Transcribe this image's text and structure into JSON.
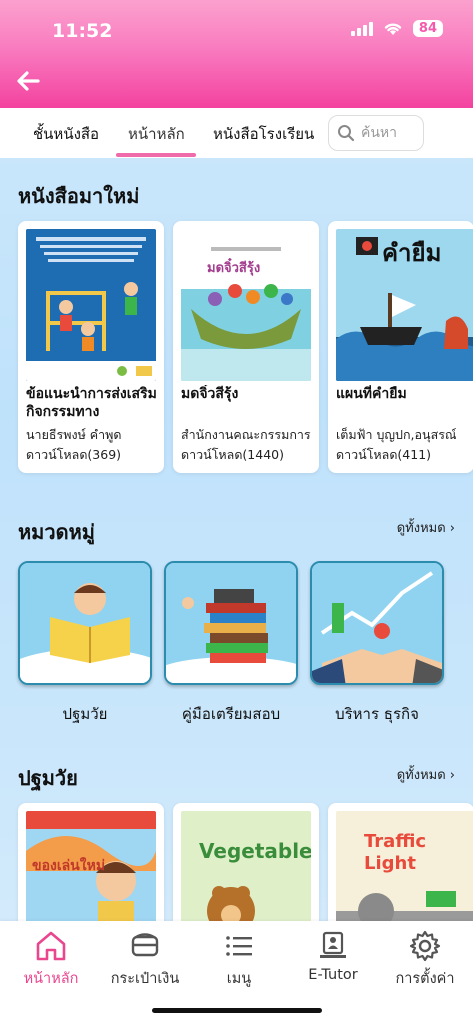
{
  "status_bar": {
    "time": "11:52",
    "battery": "84"
  },
  "header": {
    "back_icon": "arrow-left-icon"
  },
  "tabs": [
    {
      "label": "ชั้นหนังสือ"
    },
    {
      "label": "หน้าหลัก",
      "active": true
    },
    {
      "label": "หนังสือโรงเรียน"
    }
  ],
  "search": {
    "placeholder": "ค้นหา"
  },
  "new_books": {
    "title": "หนังสือมาใหม่",
    "items": [
      {
        "title": "ข้อแนะนำการส่งเสริมกิจกรรมทาง",
        "author": "นายธีรพงษ์ คำพูด",
        "downloads": "ดาวน์โหลด(369)"
      },
      {
        "title": "มดจิ๋วสีรุ้ง",
        "author": "สำนักงานคณะกรรมการ",
        "downloads": "ดาวน์โหลด(1440)"
      },
      {
        "title": "แผนที่คำยืม",
        "author": "เต็มฟ้า บุญปก,อนุสรณ์",
        "downloads": "ดาวน์โหลด(411)"
      }
    ]
  },
  "categories": {
    "title": "หมวดหมู่",
    "see_all": "ดูทั้งหมด",
    "items": [
      {
        "label": "ปฐมวัย"
      },
      {
        "label": "คู่มือเตรียมสอบ"
      },
      {
        "label": "บริหาร ธุรกิจ"
      }
    ]
  },
  "early_childhood": {
    "title": "ปฐมวัย",
    "see_all": "ดูทั้งหมด",
    "items": [
      {
        "cover_text": "ของเล่นใหม่"
      },
      {
        "cover_text": "Vegetables"
      },
      {
        "cover_text": "Traffic Light"
      }
    ]
  },
  "bottom_nav": [
    {
      "label": "หน้าหลัก",
      "icon": "home-icon",
      "active": true
    },
    {
      "label": "กระเป๋าเงิน",
      "icon": "wallet-icon"
    },
    {
      "label": "เมนู",
      "icon": "menu-icon"
    },
    {
      "label": "E-Tutor",
      "icon": "tutor-icon"
    },
    {
      "label": "การตั้งค่า",
      "icon": "gear-icon"
    }
  ],
  "colors": {
    "accent": "#ef6ba9",
    "header": "#f65aac"
  }
}
